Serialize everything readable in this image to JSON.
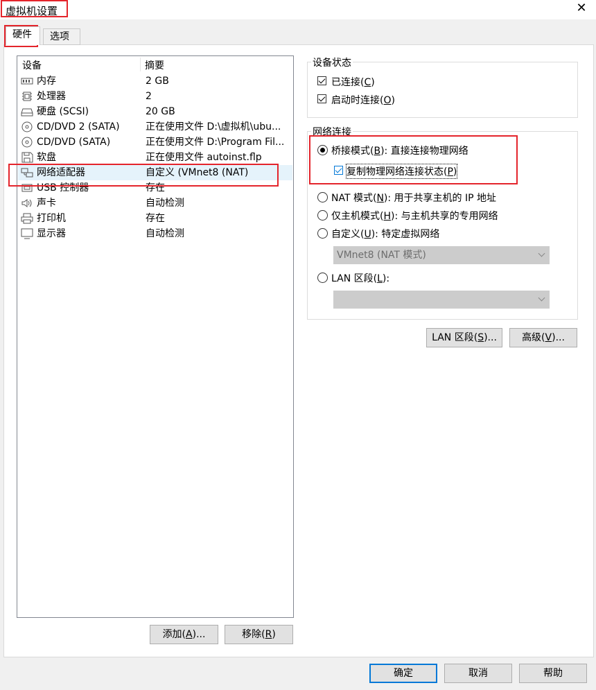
{
  "window": {
    "title": "虚拟机设置",
    "close_glyph": "✕"
  },
  "tabs": {
    "hardware": "硬件",
    "options": "选项"
  },
  "device_list": {
    "col_device": "设备",
    "col_summary": "摘要",
    "rows": [
      {
        "icon": "memory-icon",
        "name": "内存",
        "summary": "2 GB"
      },
      {
        "icon": "cpu-icon",
        "name": "处理器",
        "summary": "2"
      },
      {
        "icon": "harddisk-icon",
        "name": "硬盘 (SCSI)",
        "summary": "20 GB"
      },
      {
        "icon": "cd-dvd-icon",
        "name": "CD/DVD 2 (SATA)",
        "summary": "正在使用文件 D:\\虚拟机\\ubu..."
      },
      {
        "icon": "cd-dvd-icon",
        "name": "CD/DVD (SATA)",
        "summary": "正在使用文件 D:\\Program Fil..."
      },
      {
        "icon": "floppy-icon",
        "name": "软盘",
        "summary": "正在使用文件 autoinst.flp"
      },
      {
        "icon": "network-adapter-icon",
        "name": "网络适配器",
        "summary": "自定义 (VMnet8 (NAT)"
      },
      {
        "icon": "usb-controller-icon",
        "name": "USB 控制器",
        "summary": "存在"
      },
      {
        "icon": "sound-card-icon",
        "name": "声卡",
        "summary": "自动检测"
      },
      {
        "icon": "printer-icon",
        "name": "打印机",
        "summary": "存在"
      },
      {
        "icon": "display-icon",
        "name": "显示器",
        "summary": "自动检测"
      }
    ],
    "selected_index": 6
  },
  "left_buttons": {
    "add_label": "添加(",
    "add_key": "A",
    "add_tail": ")...",
    "remove_label": "移除(",
    "remove_key": "R",
    "remove_tail": ")"
  },
  "device_status": {
    "title": "设备状态",
    "connected": {
      "label": "已连接(",
      "key": "C",
      "tail": ")",
      "checked": true
    },
    "connect_at_power_on": {
      "label": "启动时连接(",
      "key": "O",
      "tail": ")",
      "checked": true
    }
  },
  "network": {
    "title": "网络连接",
    "bridged": {
      "label": "桥接模式(",
      "key": "B",
      "tail": "): 直接连接物理网络",
      "selected": true
    },
    "replicate": {
      "label": "复制物理网络连接状态(",
      "key": "P",
      "tail": ")",
      "checked": true
    },
    "nat": {
      "label": "NAT 模式(",
      "key": "N",
      "tail": "): 用于共享主机的 IP 地址"
    },
    "host_only": {
      "label": "仅主机模式(",
      "key": "H",
      "tail": "): 与主机共享的专用网络"
    },
    "custom": {
      "label": "自定义(",
      "key": "U",
      "tail": "): 特定虚拟网络",
      "select_value": "VMnet8 (NAT 模式)"
    },
    "lan": {
      "label": "LAN 区段(",
      "key": "L",
      "tail": "):",
      "select_value": ""
    }
  },
  "right_buttons": {
    "lan_label": "LAN 区段(",
    "lan_key": "S",
    "lan_tail": ")...",
    "advanced_label": "高级(",
    "advanced_key": "V",
    "advanced_tail": ")..."
  },
  "footer": {
    "ok": "确定",
    "cancel": "取消",
    "help": "帮助"
  },
  "colors": {
    "highlight_box": "#e4242b",
    "accent": "#0078d7",
    "selected_row": "#e5f3fb"
  }
}
